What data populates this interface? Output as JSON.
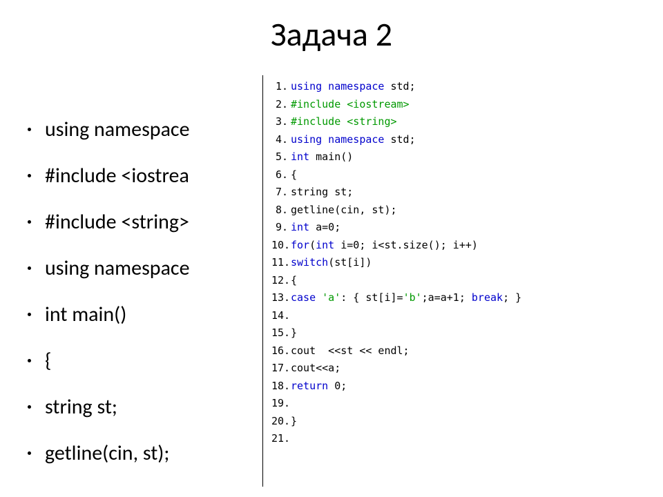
{
  "title": "Задача 2",
  "bullets": [
    "using namespace",
    "#include <iostrea",
    "#include <string>",
    "using namespace",
    "int main()",
    "{",
    "string st;",
    "getline(cin, st);"
  ],
  "code": {
    "lines": [
      {
        "n": "1.",
        "segments": [
          {
            "t": "using namespace",
            "c": "kw"
          },
          {
            "t": " std;",
            "c": "plain"
          }
        ]
      },
      {
        "n": "2.",
        "segments": [
          {
            "t": "#include <iostream>",
            "c": "pp"
          }
        ]
      },
      {
        "n": "3.",
        "segments": [
          {
            "t": "#include <string>",
            "c": "pp"
          }
        ]
      },
      {
        "n": "4.",
        "segments": [
          {
            "t": "using namespace",
            "c": "kw"
          },
          {
            "t": " std;",
            "c": "plain"
          }
        ]
      },
      {
        "n": "5.",
        "segments": [
          {
            "t": "int",
            "c": "kw"
          },
          {
            "t": " main()",
            "c": "plain"
          }
        ]
      },
      {
        "n": "6.",
        "segments": [
          {
            "t": "{",
            "c": "plain"
          }
        ]
      },
      {
        "n": "7.",
        "segments": [
          {
            "t": "string st;",
            "c": "plain"
          }
        ]
      },
      {
        "n": "8.",
        "segments": [
          {
            "t": "getline(cin, st);",
            "c": "plain"
          }
        ]
      },
      {
        "n": "9.",
        "segments": [
          {
            "t": "int",
            "c": "kw"
          },
          {
            "t": " a=0;",
            "c": "plain"
          }
        ]
      },
      {
        "n": "10.",
        "segments": [
          {
            "t": "for",
            "c": "kw"
          },
          {
            "t": "(",
            "c": "plain"
          },
          {
            "t": "int",
            "c": "kw"
          },
          {
            "t": " i=0; i<st.size(); i++)",
            "c": "plain"
          }
        ]
      },
      {
        "n": "11.",
        "segments": [
          {
            "t": "switch",
            "c": "kw"
          },
          {
            "t": "(st[i])",
            "c": "plain"
          }
        ]
      },
      {
        "n": "12.",
        "segments": [
          {
            "t": "{",
            "c": "plain"
          }
        ]
      },
      {
        "n": "13.",
        "segments": [
          {
            "t": "case",
            "c": "kw"
          },
          {
            "t": " ",
            "c": "plain"
          },
          {
            "t": "'a'",
            "c": "str"
          },
          {
            "t": ": { st[i]=",
            "c": "plain"
          },
          {
            "t": "'b'",
            "c": "str"
          },
          {
            "t": ";a=a+1; ",
            "c": "plain"
          },
          {
            "t": "break",
            "c": "kw"
          },
          {
            "t": "; }",
            "c": "plain"
          }
        ]
      },
      {
        "n": "14.",
        "segments": []
      },
      {
        "n": "15.",
        "segments": [
          {
            "t": "}",
            "c": "plain"
          }
        ]
      },
      {
        "n": "16.",
        "segments": [
          {
            "t": "cout  <<st << endl;",
            "c": "plain"
          }
        ]
      },
      {
        "n": "17.",
        "segments": [
          {
            "t": "cout<<a;",
            "c": "plain"
          }
        ]
      },
      {
        "n": "18.",
        "segments": [
          {
            "t": "return",
            "c": "kw"
          },
          {
            "t": " 0;",
            "c": "plain"
          }
        ]
      },
      {
        "n": "19.",
        "segments": []
      },
      {
        "n": "20.",
        "segments": [
          {
            "t": "}",
            "c": "plain"
          }
        ]
      },
      {
        "n": "21.",
        "segments": []
      }
    ]
  }
}
